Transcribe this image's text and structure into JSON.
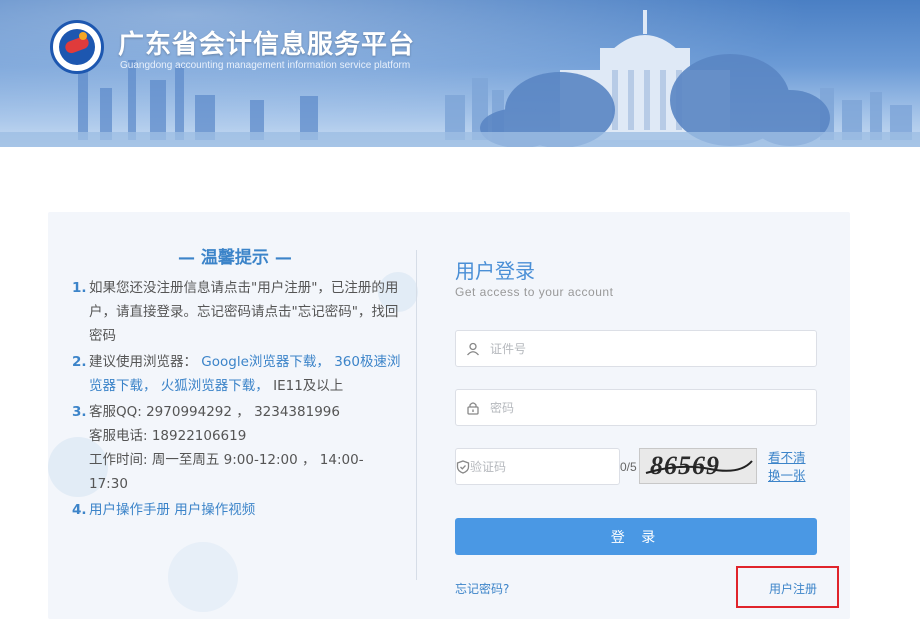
{
  "header": {
    "title": "广东省会计信息服务平台",
    "subtitle": "Guangdong accounting management information service platform"
  },
  "tips": {
    "title": "— 温馨提示 —",
    "items": [
      {
        "num": "1.",
        "text": "如果您还没注册信息请点击\"用户注册\"，已注册的用户，请直接登录。忘记密码请点击\"忘记密码\"，找回密码"
      },
      {
        "num": "2.",
        "prefix": "建议使用浏览器：",
        "link1": "Google浏览器下载，",
        "link2": "360极速浏览器下载，",
        "link3": "火狐浏览器下载，",
        "suffix": "IE11及以上"
      },
      {
        "num": "3.",
        "qq": "客服QQ: 2970994292 ， 3234381996",
        "phone": "客服电话: 18922106619",
        "hours": "工作时间: 周一至周五 9:00-12:00 ，  14:00-17:30"
      },
      {
        "num": "4.",
        "link1": "用户操作手册",
        "link2": "用户操作视频"
      }
    ]
  },
  "login": {
    "title": "用户登录",
    "subtitle": "Get access to your account",
    "id_placeholder": "证件号",
    "password_placeholder": "密码",
    "captcha_placeholder": "验证码",
    "captcha_count": "0/5",
    "captcha_text": "86569",
    "refresh_label": "看不清换一张",
    "submit_label": "登 录",
    "forgot_label": "忘记密码?",
    "register_label": "用户注册"
  },
  "colors": {
    "accent": "#3c84c9",
    "button": "#4a98e4",
    "highlight_box": "#e0242b"
  },
  "icons": {
    "id_field": "user-icon",
    "password_field": "lock-icon",
    "captcha_field": "shield-icon"
  }
}
